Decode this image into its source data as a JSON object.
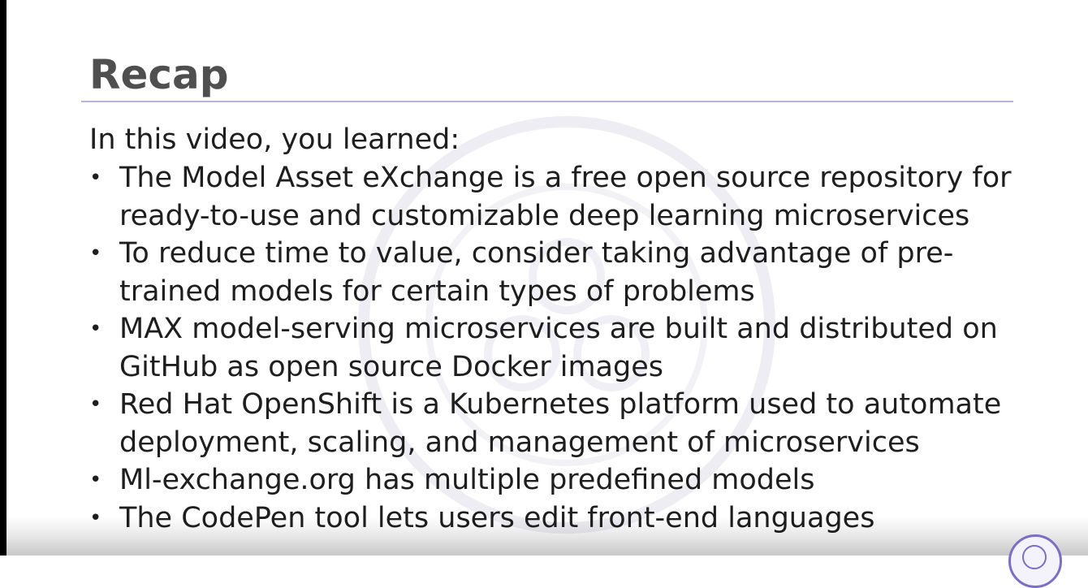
{
  "slide": {
    "title": "Recap",
    "intro": "In this video, you learned:",
    "bullets": [
      {
        "lines": [
          "The Model Asset eXchange is a free open source repository for",
          "ready-to-use and customizable deep learning microservices"
        ]
      },
      {
        "lines": [
          "To reduce time to value, consider taking advantage of pre-",
          "trained models for certain types of problems"
        ]
      },
      {
        "lines": [
          "MAX model-serving microservices are built and distributed on",
          "GitHub as open source Docker images"
        ]
      },
      {
        "lines": [
          "Red Hat OpenShift is a Kubernetes platform used to automate",
          "deployment, scaling, and management of microservices"
        ]
      },
      {
        "lines": [
          "Ml-exchange.org has multiple predefined models"
        ]
      },
      {
        "lines": [
          "The CodePen tool lets users edit front-end languages"
        ]
      }
    ],
    "bullet_glyph": "•"
  },
  "colors": {
    "title": "#4f4f4f",
    "body_text": "#1e1e1e",
    "title_rule": "#b8b6d4",
    "watermark": "#ececf2",
    "left_bar": "#000000"
  },
  "icons": {
    "watermark": "watermark-logo",
    "corner": "corner-logo"
  }
}
